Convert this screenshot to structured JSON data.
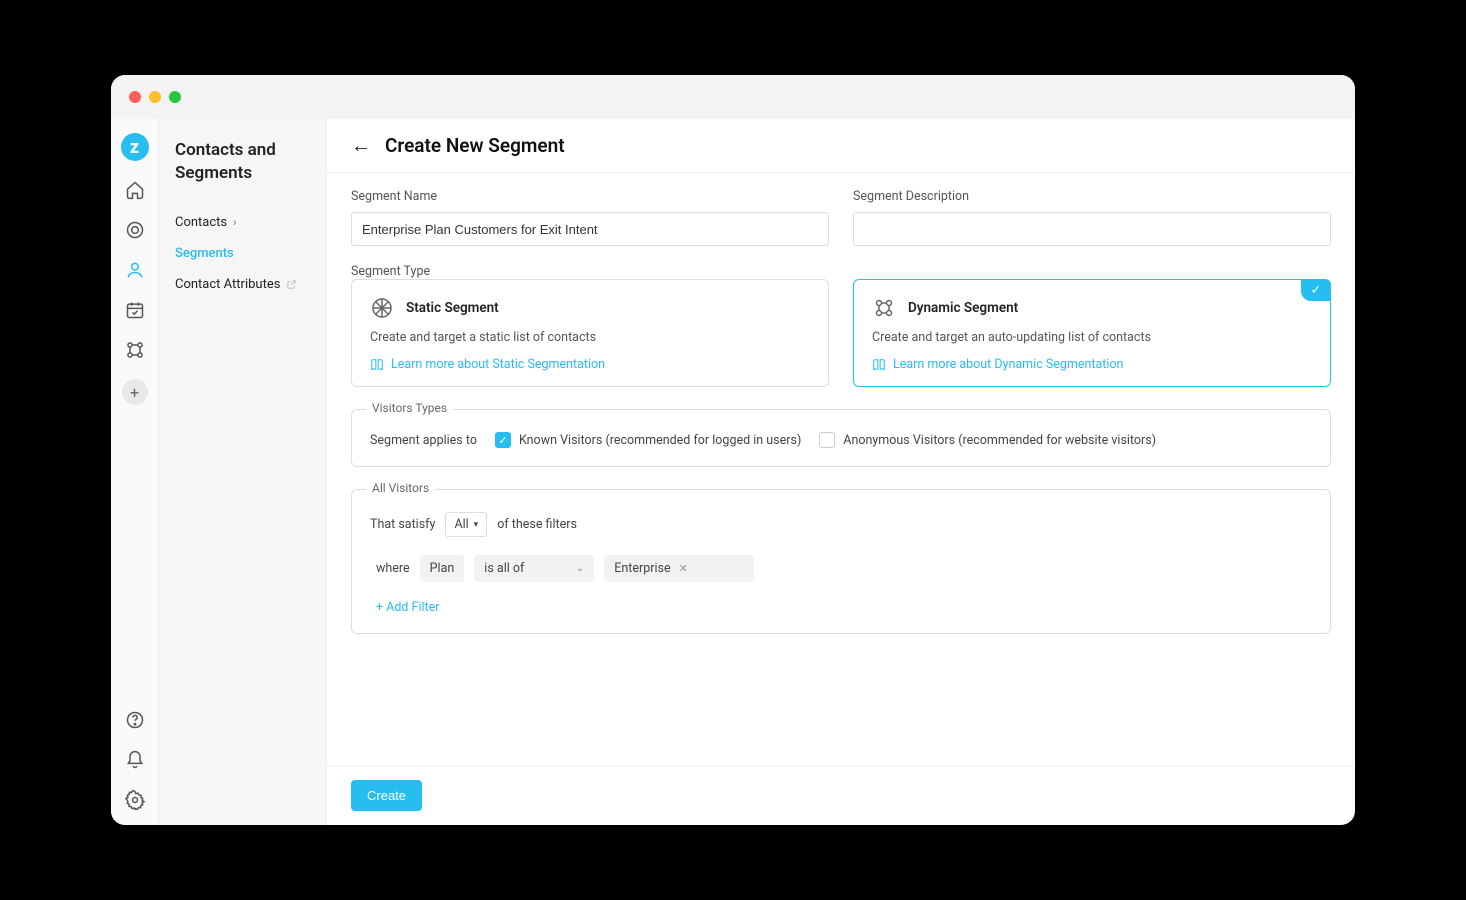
{
  "sidebar": {
    "title": "Contacts and Segments",
    "items": [
      {
        "label": "Contacts",
        "hasChevron": true
      },
      {
        "label": "Segments",
        "active": true
      },
      {
        "label": "Contact Attributes",
        "external": true
      }
    ]
  },
  "header": {
    "title": "Create New Segment"
  },
  "form": {
    "name_label": "Segment Name",
    "name_value": "Enterprise Plan Customers for Exit Intent",
    "desc_label": "Segment Description",
    "desc_value": "",
    "type_label": "Segment Type",
    "static": {
      "title": "Static Segment",
      "desc": "Create and target a static list of contacts",
      "learn": "Learn more about Static Segmentation"
    },
    "dynamic": {
      "title": "Dynamic Segment",
      "desc": "Create and target an auto-updating list of contacts",
      "learn": "Learn more about Dynamic Segmentation"
    }
  },
  "visitors": {
    "legend": "Visitors Types",
    "applies_label": "Segment applies to",
    "known_label": "Known Visitors (recommended for logged in users)",
    "anon_label": "Anonymous Visitors (recommended for website visitors)"
  },
  "filters": {
    "legend": "All Visitors",
    "satisfy_pre": "That satisfy",
    "satisfy_mode": "All",
    "satisfy_post": "of these filters",
    "where_label": "where",
    "attr": "Plan",
    "op": "is all of",
    "value": "Enterprise",
    "add_label": "+ Add Filter"
  },
  "footer": {
    "create_label": "Create"
  }
}
